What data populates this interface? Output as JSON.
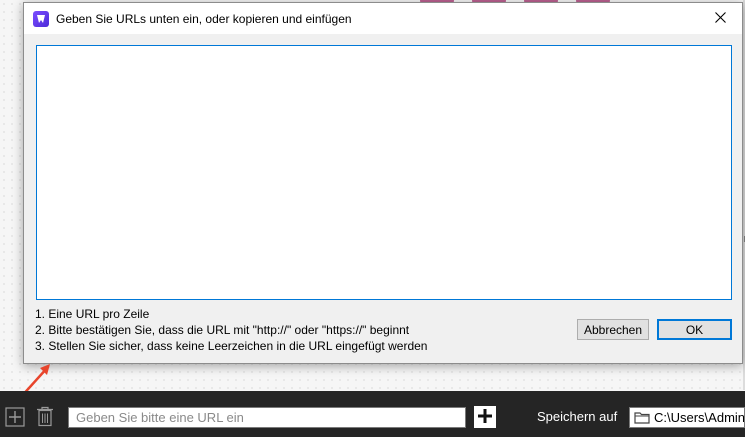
{
  "dialog": {
    "title": "Geben Sie URLs unten ein, oder kopieren und einfügen",
    "url_list_value": "",
    "instructions": [
      "1. Eine URL pro Zeile",
      "2. Bitte bestätigen Sie, dass die URL mit \"http://\" oder \"https://\" beginnt",
      "3. Stellen Sie sicher, dass keine Leerzeichen in die URL eingefügt werden"
    ],
    "cancel_label": "Abbrechen",
    "ok_label": "OK",
    "close_icon": "close-icon",
    "app_icon": "app-logo-icon"
  },
  "toolbar": {
    "url_placeholder": "Geben Sie bitte eine URL ein",
    "save_label": "Speichern auf",
    "save_path": "C:\\Users\\Admin",
    "icons": [
      "add-icon",
      "trash-icon",
      "add-url-icon",
      "folder-icon"
    ]
  },
  "colors": {
    "accent": "#0078d7",
    "toolbar_bg": "#252525",
    "annotation_arrow": "#e8452c",
    "app_icon": "#6a3df0"
  }
}
